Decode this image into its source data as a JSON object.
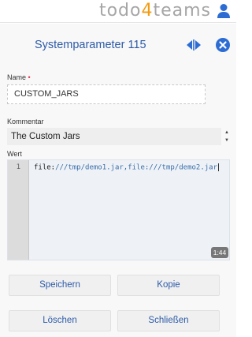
{
  "header": {
    "brand_pre": "todo",
    "brand_four": "4",
    "brand_post": "teams",
    "brand_accent": "#f39c12",
    "user_icon": "user-icon"
  },
  "dialog": {
    "title": "Systemparameter 115",
    "toggle_icon": "swap-horizontal-icon",
    "close_icon": "close-circle-icon"
  },
  "form": {
    "name_label": "Name",
    "required_marker": "•",
    "name_value": "CUSTOM_JARS",
    "comment_label": "Kommentar",
    "comment_value": "The Custom Jars",
    "value_label": "Wert",
    "editor": {
      "line_number": "1",
      "keyword": "file:",
      "code_rest": "///tmp/demo1.jar,file:///tmp/demo2.jar",
      "cursor_position": "1:44"
    }
  },
  "buttons": {
    "save": "Speichern",
    "copy": "Kopie",
    "delete": "Löschen",
    "close": "Schließen"
  },
  "colors": {
    "accent_blue": "#2d5aa8",
    "required_red": "#e0334e"
  }
}
